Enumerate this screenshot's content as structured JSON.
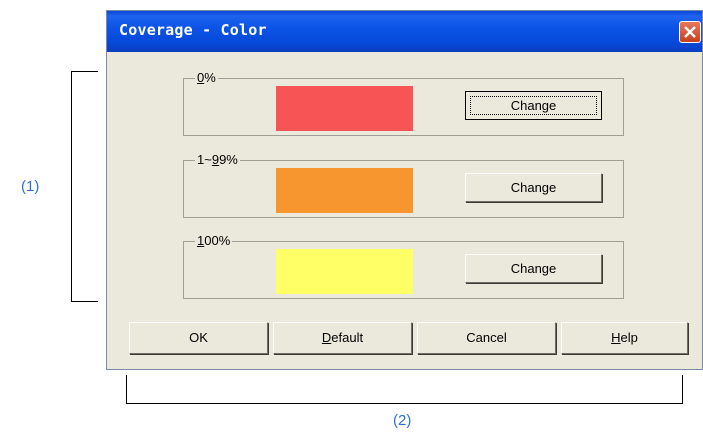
{
  "annotations": {
    "left": "(1)",
    "bottom": "(2)"
  },
  "dialog": {
    "title": "Coverage - Color",
    "close_icon": "close-icon"
  },
  "groups": [
    {
      "label_mn": "0",
      "label_rest": "%",
      "color": "#f75555",
      "button": "Change"
    },
    {
      "label_pre": "1~",
      "label_mn": "9",
      "label_rest": "9%",
      "color": "#f7952f",
      "button": "Change"
    },
    {
      "label_pre": "",
      "label_mn": "1",
      "label_rest": "00%",
      "color": "#ffff66",
      "button": "Change"
    }
  ],
  "buttons": {
    "ok": "OK",
    "default_mn": "D",
    "default_rest": "efault",
    "cancel": "Cancel",
    "help_mn": "H",
    "help_rest": "elp"
  }
}
